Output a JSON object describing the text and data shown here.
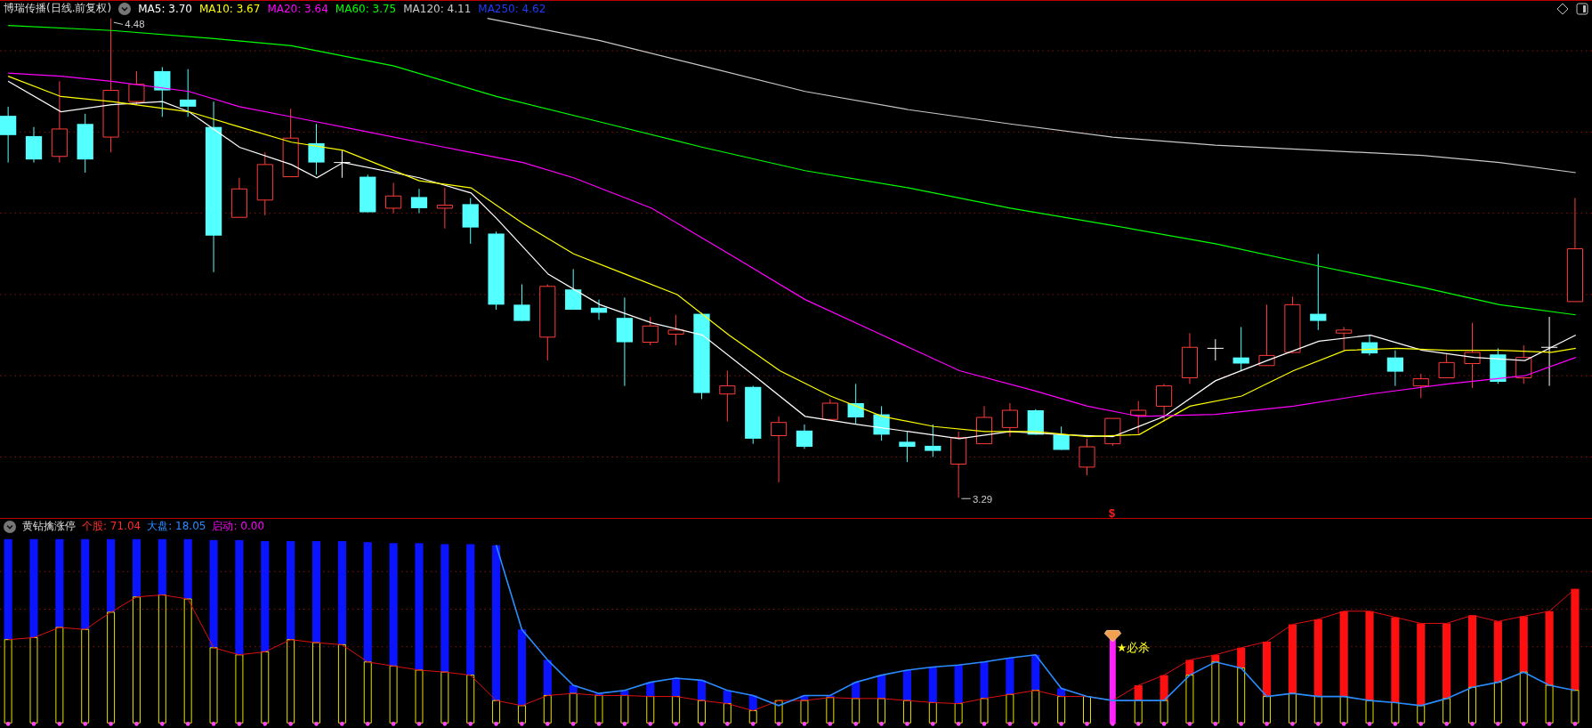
{
  "chart_header": {
    "title": "博瑞传播(日线.前复权)",
    "moving_averages": [
      {
        "text": "MA5: 3.70",
        "color": "#ffffff"
      },
      {
        "text": "MA10: 3.67",
        "color": "#ffff00"
      },
      {
        "text": "MA20: 3.64",
        "color": "#ff00ff"
      },
      {
        "text": "MA60: 3.75",
        "color": "#00ff00"
      },
      {
        "text": "MA120: 4.11",
        "color": "#c8c8c8"
      },
      {
        "text": "MA250: 4.62",
        "color": "#1f3cff"
      }
    ]
  },
  "price_labels": {
    "high": "4.48",
    "low": "3.29"
  },
  "marker": "$",
  "indicator_header": {
    "title": "黄钻擒涨停",
    "values": [
      {
        "text": "个股: 71.04",
        "color": "#ff2a2a"
      },
      {
        "text": "大盘: 18.05",
        "color": "#2a8cff"
      },
      {
        "text": "启动: 0.00",
        "color": "#ff00ff"
      }
    ]
  },
  "signal_label": "★必杀"
}
